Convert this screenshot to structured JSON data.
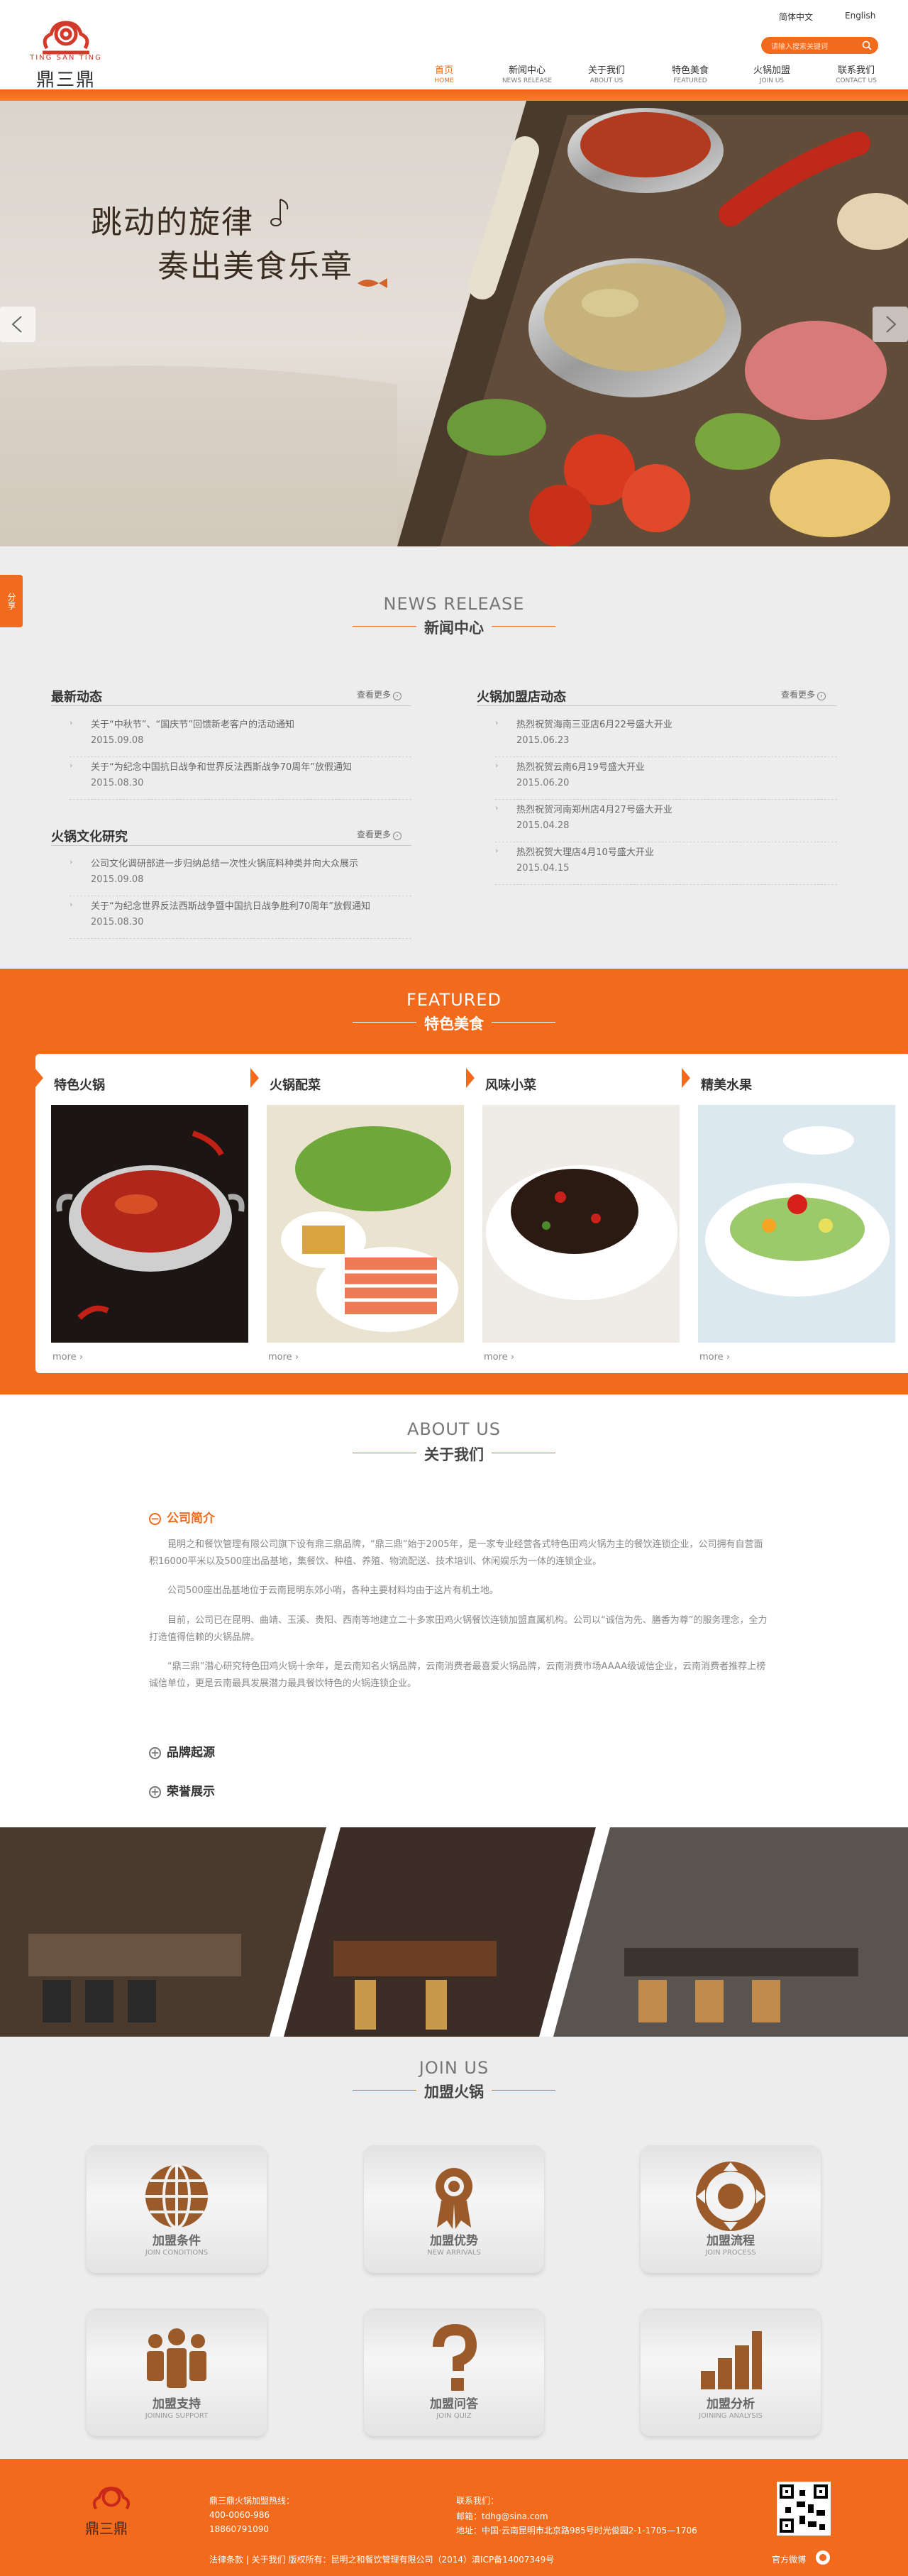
{
  "header": {
    "logo_sub": "TING SAN TING",
    "logo_name": "鼎三鼎",
    "lang_zh": "简体中文",
    "lang_en": "English",
    "search_placeholder": "请输入搜索关键词",
    "nav": [
      {
        "zh": "首页",
        "en": "HOME",
        "active": true
      },
      {
        "zh": "新闻中心",
        "en": "NEWS RELEASE"
      },
      {
        "zh": "关于我们",
        "en": "ABOUT US"
      },
      {
        "zh": "特色美食",
        "en": "FEATURED"
      },
      {
        "zh": "火锅加盟",
        "en": "JOIN US"
      },
      {
        "zh": "联系我们",
        "en": "CONTACT US"
      }
    ]
  },
  "banner": {
    "line1": "跳动的旋律",
    "line2": "奏出美食乐章"
  },
  "share": "分享",
  "news": {
    "title_en": "NEWS RELEASE",
    "title_zh": "新闻中心",
    "more": "查看更多",
    "blocks": [
      {
        "title": "最新动态",
        "items": [
          {
            "t": "关于“中秋节”、“国庆节”回馈新老客户的活动通知",
            "d": "2015.09.08"
          },
          {
            "t": "关于“为纪念中国抗日战争和世界反法西斯战争70周年”放假通知",
            "d": "2015.08.30"
          }
        ]
      },
      {
        "title": "火锅加盟店动态",
        "items": [
          {
            "t": "热烈祝贺海南三亚店6月22号盛大开业",
            "d": "2015.06.23"
          },
          {
            "t": "热烈祝贺云南6月19号盛大开业",
            "d": "2015.06.20"
          },
          {
            "t": "热烈祝贺河南郑州店4月27号盛大开业",
            "d": "2015.04.28"
          },
          {
            "t": "热烈祝贺大理店4月10号盛大开业",
            "d": "2015.04.15"
          }
        ]
      },
      {
        "title": "火锅文化研究",
        "items": [
          {
            "t": "公司文化调研部进一步归纳总结一次性火锅底料种类并向大众展示",
            "d": "2015.09.08"
          },
          {
            "t": "关于“为纪念世界反法西斯战争暨中国抗日战争胜利70周年”放假通知",
            "d": "2015.08.30"
          }
        ]
      }
    ]
  },
  "featured": {
    "title_en": "FEATURED",
    "title_zh": "特色美食",
    "more": "more",
    "cards": [
      {
        "name": "特色火锅"
      },
      {
        "name": "火锅配菜"
      },
      {
        "name": "风味小菜"
      },
      {
        "name": "精美水果"
      }
    ]
  },
  "about": {
    "title_en": "ABOUT US",
    "title_zh": "关于我们",
    "sec1": "公司简介",
    "paras": [
      "昆明之和餐饮管理有限公司旗下设有鼎三鼎品牌，“鼎三鼎”始于2005年，是一家专业经营各式特色田鸡火锅为主的餐饮连锁企业，公司拥有自营面积16000平米以及500座出品基地，集餐饮、种植、养殖、物流配送、技术培训、休闲娱乐为一体的连锁企业。",
      "公司500座出品基地位于云南昆明东郊小哨，各种主要材料均由于这片有机土地。",
      "目前，公司已在昆明、曲靖、玉溪、贵阳、西南等地建立二十多家田鸡火锅餐饮连锁加盟直属机构。公司以“诚信为先、膳香为尊”的服务理念，全力打造值得信赖的火锅品牌。",
      "“鼎三鼎”潜心研究特色田鸡火锅十余年，是云南知名火锅品牌，云南消费者最喜爱火锅品牌，云南消费市场AAAA级诚信企业，云南消费者推荐上榜诚信单位，更是云南最具发展潜力最具餐饮特色的火锅连锁企业。"
    ],
    "sec2": "品牌起源",
    "sec3": "荣誉展示"
  },
  "join": {
    "title_en": "JOIN US",
    "title_zh": "加盟火锅",
    "items": [
      {
        "zh": "加盟条件",
        "en": "JOIN CONDITIONS",
        "icon": "globe-icon"
      },
      {
        "zh": "加盟优势",
        "en": "NEW ARRIVALS",
        "icon": "award-ribbon-icon"
      },
      {
        "zh": "加盟流程",
        "en": "JOIN PROCESS",
        "icon": "cycle-arrows-icon"
      },
      {
        "zh": "加盟支持",
        "en": "JOINING SUPPORT",
        "icon": "team-icon"
      },
      {
        "zh": "加盟问答",
        "en": "JOIN QUIZ",
        "icon": "question-mark-icon"
      },
      {
        "zh": "加盟分析",
        "en": "JOINING ANALYSIS",
        "icon": "bar-chart-icon"
      }
    ]
  },
  "footer": {
    "logo_name": "鼎三鼎",
    "hotline_label": "鼎三鼎火锅加盟热线：",
    "phone1": "400-0060-986",
    "phone2": "18860791090",
    "contact_label": "联系我们：",
    "email": "邮箱：tdhg@sina.com",
    "address": "地址：中国·云南昆明市北京路985号时光俊园2-1-1705—1706",
    "bottom": "法律条款 | 关于我们    版权所有：昆明之和餐饮管理有限公司（2014）滇ICP备14007349号",
    "weibo": "官方微博"
  },
  "colors": {
    "accent": "#f26a1b",
    "bg_gray": "#ededed"
  }
}
